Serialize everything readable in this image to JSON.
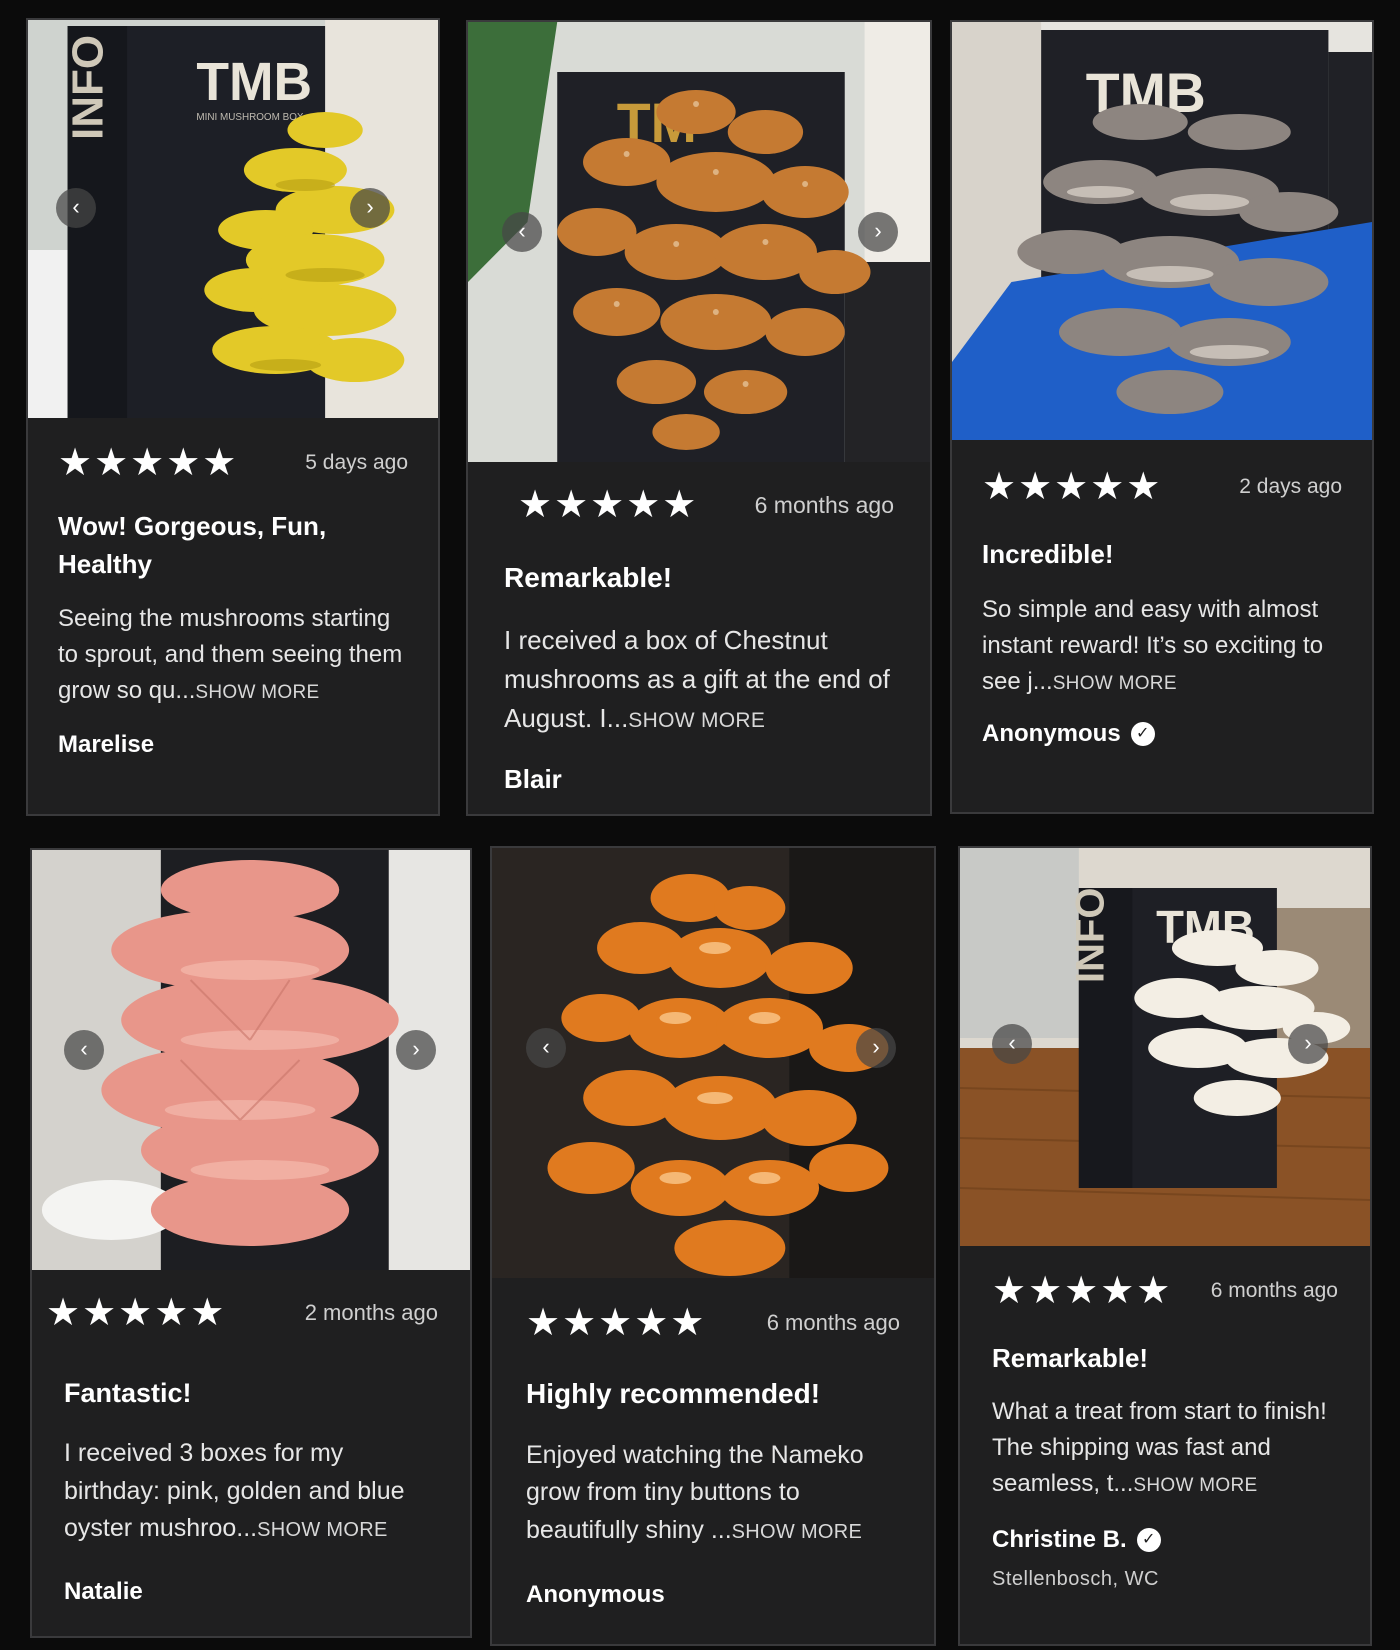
{
  "nav": {
    "prev": "‹",
    "next": "›"
  },
  "reviews": [
    {
      "image": "yellow-oyster-mushrooms-photo",
      "box_label": "TMB",
      "box_side_label": "INFO",
      "box_sub_label": "MINI MUSHROOM BOX",
      "rating": 5,
      "stars": "★★★★★",
      "date": "5 days ago",
      "title": "Wow! Gorgeous, Fun, Healthy",
      "text": "Seeing the mushrooms starting to sprout, and them seeing them grow so qu...",
      "show_more": "SHOW MORE",
      "author": "Marelise",
      "verified": false
    },
    {
      "image": "chestnut-mushrooms-photo",
      "box_label": "TM",
      "rating": 5,
      "stars": "★★★★★",
      "date": "6 months ago",
      "title": "Remarkable!",
      "text": "I received a box of Chestnut mushrooms as a gift at the end of August. I...",
      "show_more": "SHOW MORE",
      "author": "Blair",
      "verified": false
    },
    {
      "image": "blue-oyster-mushrooms-photo",
      "box_label": "TMB",
      "rating": 5,
      "stars": "★★★★★",
      "date": "2 days ago",
      "title": "Incredible!",
      "text": "So simple and easy with almost instant reward! It’s so exciting to see j...",
      "show_more": "SHOW MORE",
      "author": "Anonymous",
      "verified": true
    },
    {
      "image": "pink-oyster-mushrooms-photo",
      "rating": 5,
      "stars": "★★★★★",
      "date": "2 months ago",
      "title": "Fantastic!",
      "text": "I received 3 boxes for my birthday: pink, golden and blue oyster mushroo...",
      "show_more": "SHOW MORE",
      "author": "Natalie",
      "verified": false
    },
    {
      "image": "nameko-mushrooms-photo",
      "rating": 5,
      "stars": "★★★★★",
      "date": "6 months ago",
      "title": "Highly recommended!",
      "text": "Enjoyed watching the Nameko grow from tiny buttons to beautifully shiny ...",
      "show_more": "SHOW MORE",
      "author": "Anonymous",
      "verified": false
    },
    {
      "image": "white-oyster-mushrooms-photo",
      "box_label": "TMB",
      "box_side_label": "INFO",
      "rating": 5,
      "stars": "★★★★★",
      "date": "6 months ago",
      "title": "Remarkable!",
      "text": "What a treat from start to finish! The shipping was fast and seamless, t...",
      "show_more": "SHOW MORE",
      "author": "Christine B.",
      "verified": true,
      "location": "Stellenbosch, WC"
    }
  ],
  "colors": {
    "card_bg": "#1f1f20",
    "card_border": "#3a3a3c",
    "page_bg": "#000000",
    "text": "#ffffff",
    "muted": "#cfcfcf"
  }
}
